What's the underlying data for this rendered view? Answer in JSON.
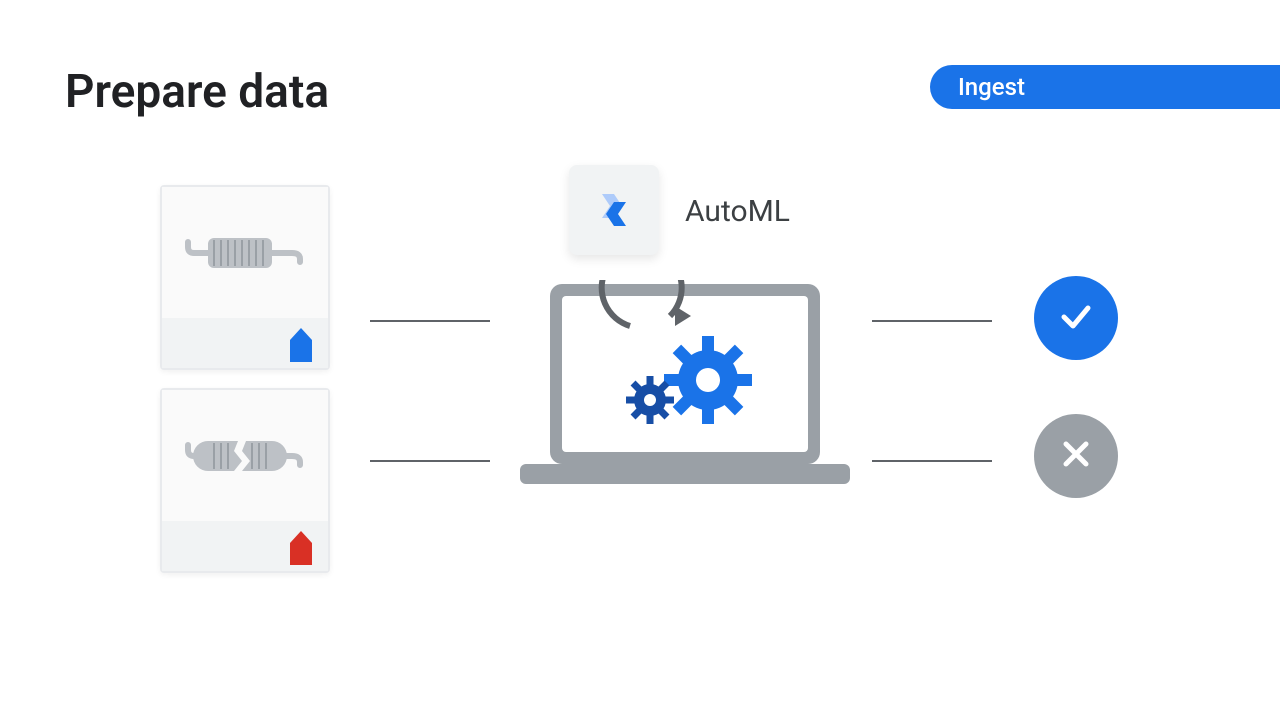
{
  "title": "Prepare data",
  "pill_label": "Ingest",
  "automl_label": "AutoML",
  "colors": {
    "brand_blue": "#1a73e8",
    "accent_red": "#d93025",
    "neutral_gray": "#9aa0a6"
  },
  "inputs": [
    {
      "tag_color": "blue",
      "icon": "muffler-intact-icon"
    },
    {
      "tag_color": "red",
      "icon": "muffler-broken-icon"
    }
  ],
  "outputs": [
    {
      "status": "ok",
      "icon": "check-icon"
    },
    {
      "status": "bad",
      "icon": "cross-icon"
    }
  ]
}
